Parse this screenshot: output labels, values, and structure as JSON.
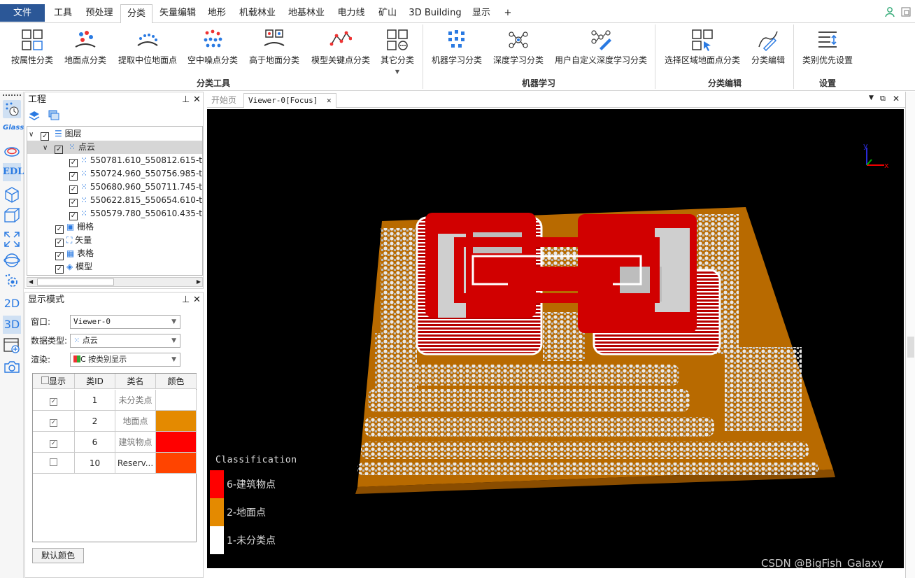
{
  "menu": {
    "file": "文件",
    "tabs": [
      "工具",
      "预处理",
      "分类",
      "矢量编辑",
      "地形",
      "机载林业",
      "地基林业",
      "电力线",
      "矿山",
      "3D Building",
      "显示",
      "+"
    ],
    "active_tab": "分类"
  },
  "ribbon": {
    "buttons": [
      {
        "label": "按属性分类",
        "icon": "attribute-classify-icon"
      },
      {
        "label": "地面点分类",
        "icon": "ground-classify-icon"
      },
      {
        "label": "提取中位地面点",
        "icon": "median-ground-icon"
      },
      {
        "label": "空中噪点分类",
        "icon": "air-noise-icon"
      },
      {
        "label": "高于地面分类",
        "icon": "above-ground-icon"
      },
      {
        "label": "模型关键点分类",
        "icon": "model-keypoint-icon"
      },
      {
        "label": "其它分类",
        "icon": "other-classify-icon"
      },
      {
        "label": "机器学习分类",
        "icon": "ml-classify-icon"
      },
      {
        "label": "深度学习分类",
        "icon": "dl-classify-icon"
      },
      {
        "label": "用户自定义深度学习分类",
        "icon": "custom-dl-icon"
      },
      {
        "label": "选择区域地面点分类",
        "icon": "region-ground-icon"
      },
      {
        "label": "分类编辑",
        "icon": "classify-edit-icon"
      },
      {
        "label": "类别优先设置",
        "icon": "class-priority-icon"
      }
    ],
    "groups": [
      "分类工具",
      "机器学习",
      "分类编辑",
      "设置"
    ]
  },
  "left_tools": [
    "Glass",
    "EDL",
    "2D",
    "3D"
  ],
  "project": {
    "title": "工程",
    "root": "图层",
    "pointcloud": "点云",
    "files": [
      "550781.610_550812.615-tr",
      "550724.960_550756.985-tr",
      "550680.960_550711.745-tr",
      "550622.815_550654.610-tr",
      "550579.780_550610.435-tr"
    ],
    "others": [
      "栅格",
      "矢量",
      "表格",
      "模型"
    ]
  },
  "display": {
    "title": "显示模式",
    "window_label": "窗口:",
    "window_value": "Viewer-0",
    "dtype_label": "数据类型:",
    "dtype_value": "点云",
    "render_label": "渲染:",
    "render_value": "按类别显示",
    "table_headers": [
      "显示",
      "类ID",
      "类名",
      "颜色"
    ],
    "rows": [
      {
        "checked": true,
        "id": "1",
        "name": "未分类点",
        "color": "#ffffff"
      },
      {
        "checked": true,
        "id": "2",
        "name": "地面点",
        "color": "#e48a00"
      },
      {
        "checked": true,
        "id": "6",
        "name": "建筑物点",
        "color": "#ff0000"
      },
      {
        "checked": false,
        "id": "10",
        "name": "Reserv...",
        "color": "#ff4400"
      }
    ],
    "default_button": "默认颜色"
  },
  "viewer": {
    "tabs": [
      "开始页",
      "Viewer-0[Focus]"
    ],
    "legend_title": "Classification",
    "legend": [
      {
        "label": "6-建筑物点",
        "color": "#ff0000"
      },
      {
        "label": "2-地面点",
        "color": "#e48a00"
      },
      {
        "label": "1-未分类点",
        "color": "#ffffff"
      }
    ],
    "watermark": "CSDN @BigFish_Galaxy",
    "axis_x": "x",
    "axis_y": "y"
  }
}
